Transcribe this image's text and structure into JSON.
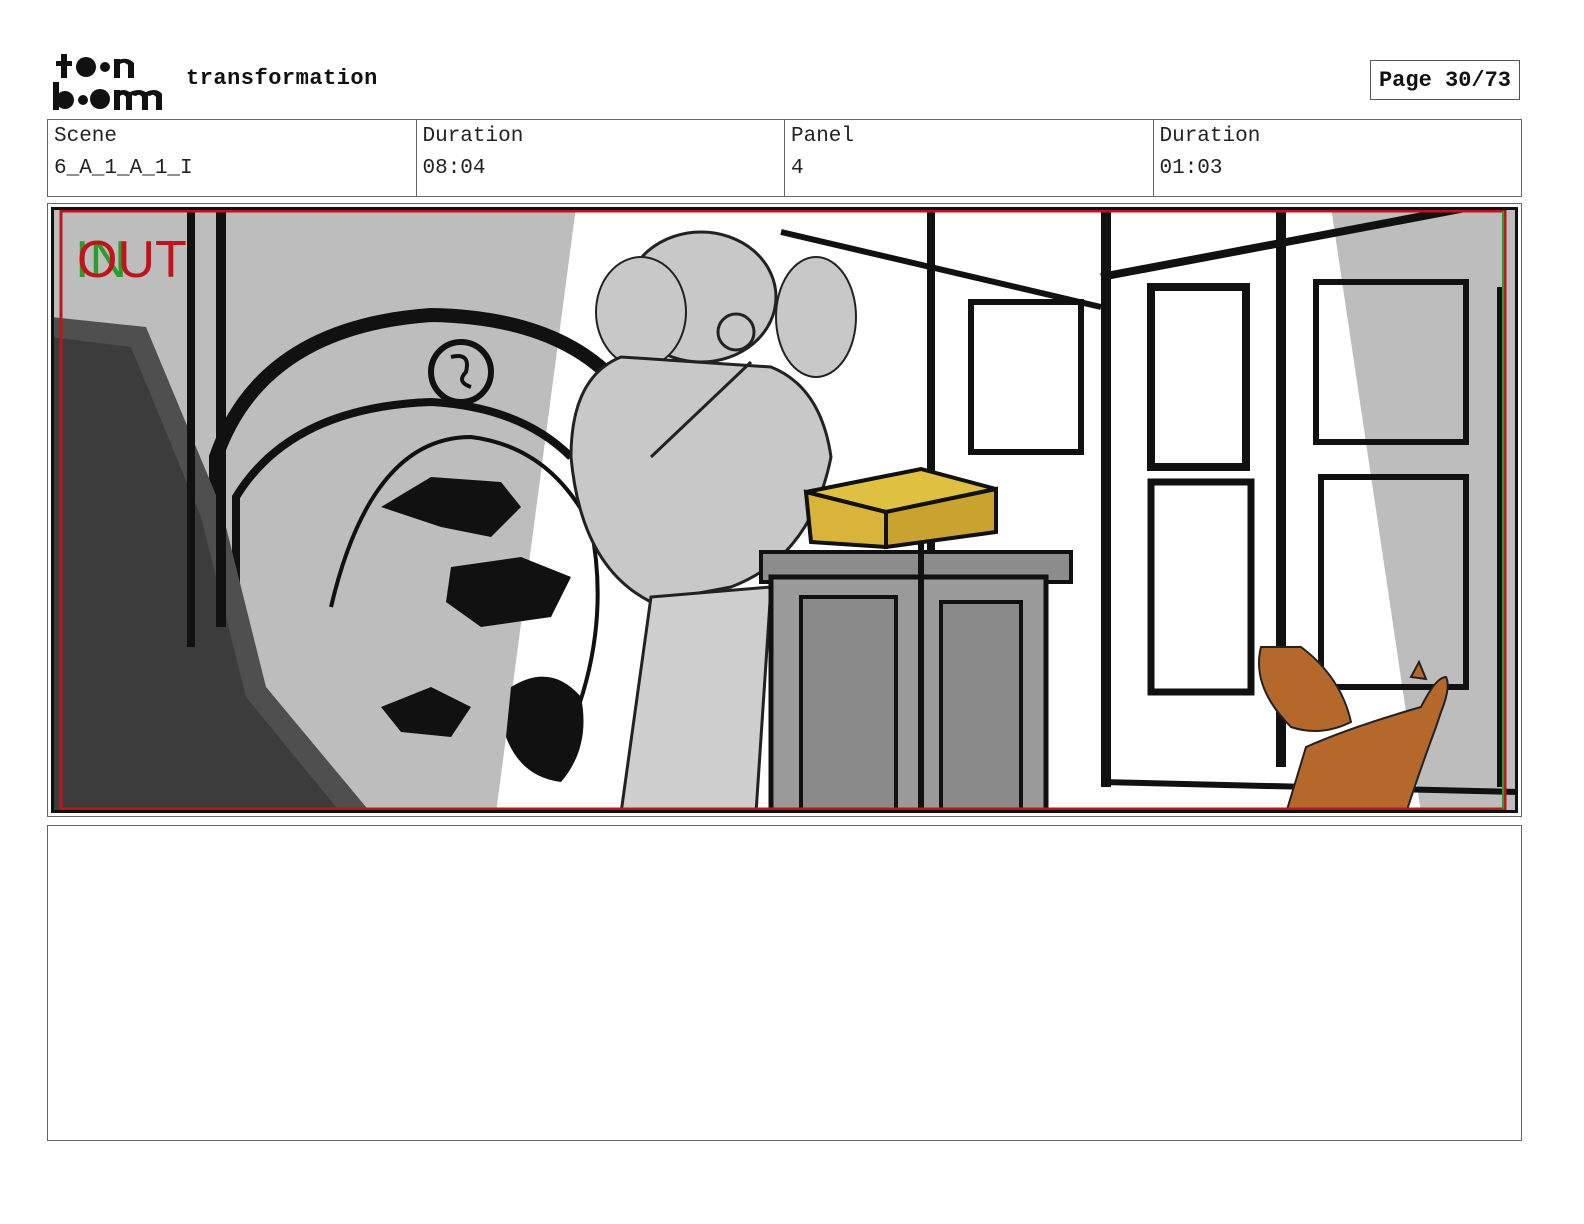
{
  "header": {
    "logo_text": "toon boom",
    "project_title": "transformation",
    "page_label": "Page 30/73"
  },
  "info": {
    "scene_label": "Scene",
    "scene_value": "6_A_1_A_1_I",
    "scene_duration_label": "Duration",
    "scene_duration_value": "08:04",
    "panel_label": "Panel",
    "panel_value": "4",
    "panel_duration_label": "Duration",
    "panel_duration_value": "01:03"
  },
  "panel": {
    "in_marker": "IN",
    "out_marker": "OUT",
    "colors": {
      "safe_frame": "#c0141a",
      "in_marker": "#2a9d2a",
      "out_marker": "#c0141a",
      "box": "#d9b43a",
      "fox": "#b5682b",
      "wall_gray": "#bdbdbd",
      "dark_gray": "#555555"
    }
  },
  "notes": {
    "text": ""
  }
}
